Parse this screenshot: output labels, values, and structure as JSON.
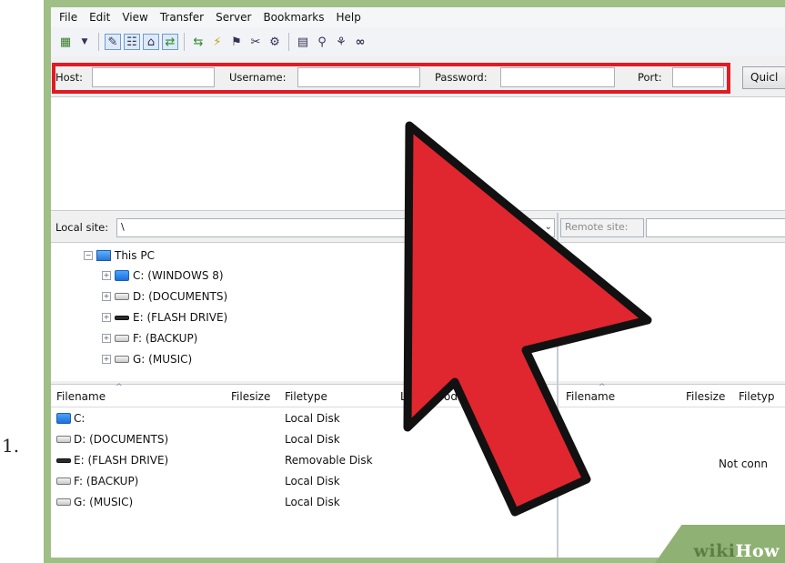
{
  "list_number": "1.",
  "menu": [
    "File",
    "Edit",
    "View",
    "Transfer",
    "Server",
    "Bookmarks",
    "Help"
  ],
  "quickconnect": {
    "host_label": "Host:",
    "username_label": "Username:",
    "password_label": "Password:",
    "port_label": "Port:",
    "button_label": "Quicl",
    "highlight_color": "#e01b24"
  },
  "local_site": {
    "label": "Local site:",
    "path": "\\"
  },
  "remote_site": {
    "label": "Remote site:"
  },
  "tree": {
    "root": "This PC",
    "drives": [
      {
        "label": "C: (WINDOWS 8)",
        "icon": "windows-drive-icon"
      },
      {
        "label": "D: (DOCUMENTS)",
        "icon": "hard-drive-icon"
      },
      {
        "label": "E: (FLASH DRIVE)",
        "icon": "flash-drive-icon"
      },
      {
        "label": "F: (BACKUP)",
        "icon": "hard-drive-icon"
      },
      {
        "label": "G: (MUSIC)",
        "icon": "hard-drive-icon"
      }
    ]
  },
  "local_files": {
    "columns": {
      "filename": "Filename",
      "filesize": "Filesize",
      "filetype": "Filetype",
      "modified_partial": "L",
      "modified_tail": "odified"
    },
    "rows": [
      {
        "name": "C:",
        "type": "Local Disk"
      },
      {
        "name": "D: (DOCUMENTS)",
        "type": "Local Disk"
      },
      {
        "name": "E: (FLASH DRIVE)",
        "type": "Removable Disk"
      },
      {
        "name": "F: (BACKUP)",
        "type": "Local Disk"
      },
      {
        "name": "G: (MUSIC)",
        "type": "Local Disk"
      }
    ]
  },
  "remote_files": {
    "columns": {
      "filename": "Filename",
      "filesize": "Filesize",
      "filetype": "Filetyp"
    },
    "status": "Not conn"
  },
  "watermark": {
    "wiki": "wiki",
    "how": "How"
  },
  "colors": {
    "arrow_fill": "#e0262f",
    "arrow_outline": "#111111",
    "frame_green": "#9fbf86"
  }
}
